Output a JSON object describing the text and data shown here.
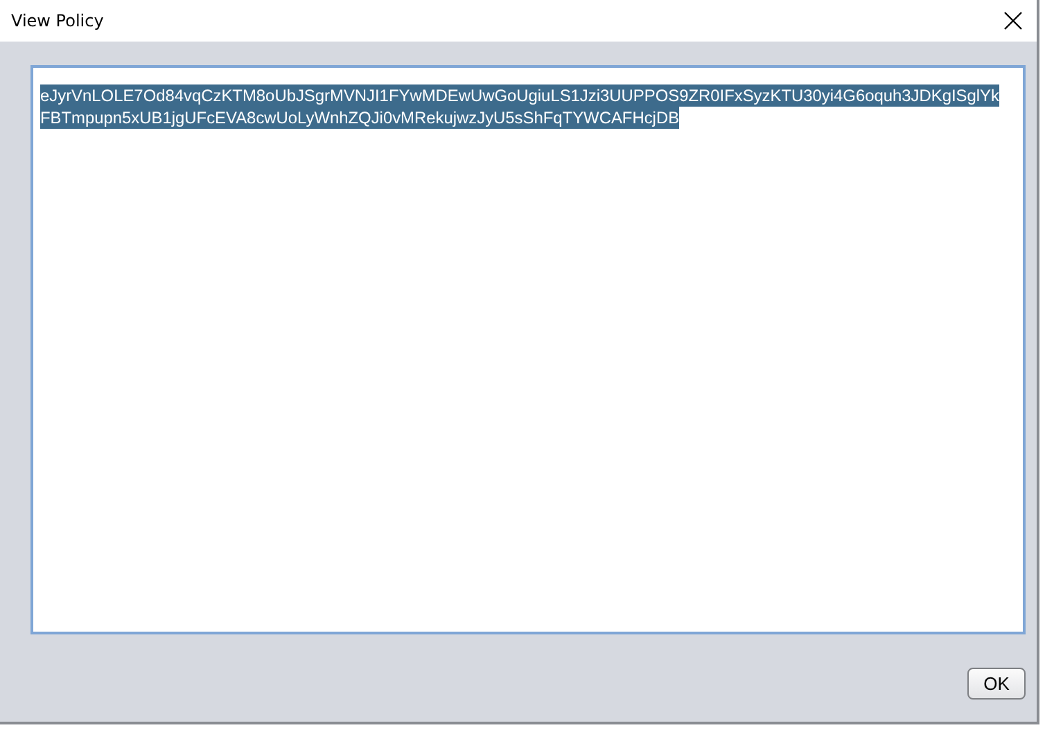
{
  "window": {
    "title": "View Policy"
  },
  "policy_text": {
    "lines": [
      "eJyrVnLOLE7Od84vqCzKTM8oUbJSgrMVNJI1FYwMDEwUwGoUgiuLS1Jzi3UUPPOS9ZR0IFxSyzKTU30yi4G6oquh3JDKgISglYk",
      "FBTmpupn5xUB1jgUFcEVA8cwUoLyWnhZQJi0vMRekujwzJyU5sShFqTYWCAFHcjDB"
    ],
    "selected": true
  },
  "buttons": [
    {
      "label": "OK"
    }
  ]
}
